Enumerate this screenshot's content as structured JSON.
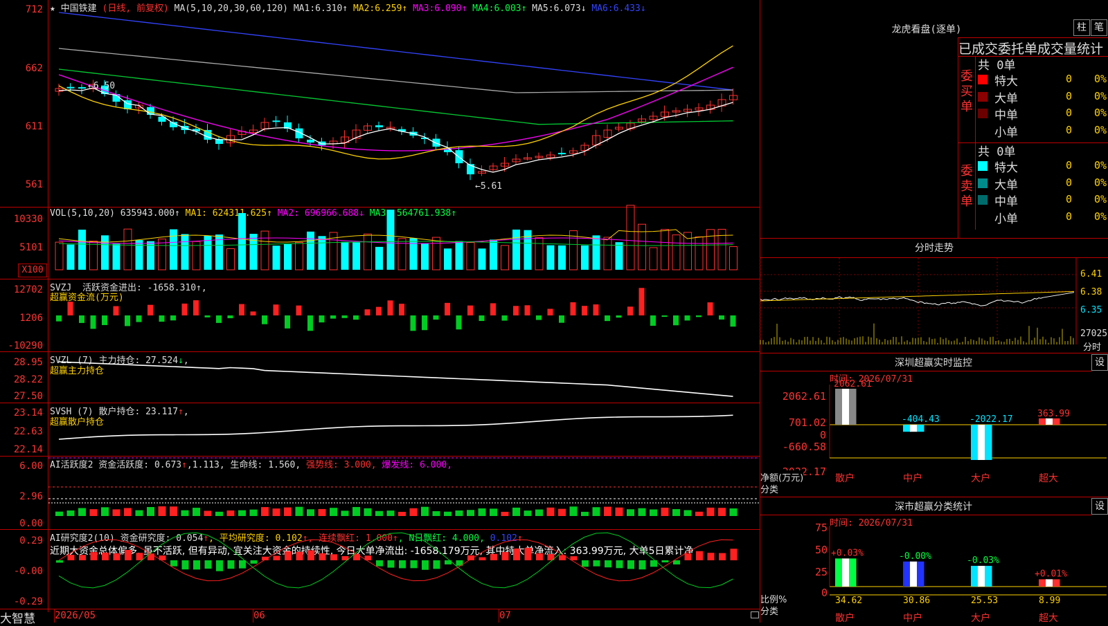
{
  "main": {
    "star": "★",
    "stock_name": "中国铁建",
    "period": "(日线, 前复权)",
    "ma_label": "MA(5,10,20,30,60,120)",
    "ma_values": [
      {
        "name": "MA1:",
        "value": "6.310↑",
        "color": "#dddddd"
      },
      {
        "name": "MA2:",
        "value": "6.259↑",
        "color": "#ffd200"
      },
      {
        "name": "MA3:",
        "value": "6.090↑",
        "color": "#ff00ff"
      },
      {
        "name": "MA4:",
        "value": "6.003↑",
        "color": "#00ff44"
      },
      {
        "name": "MA5:",
        "value": "6.073↓",
        "color": "#aaaaaa"
      },
      {
        "name": "MA6:",
        "value": "6.433↓",
        "color": "#3344ff"
      }
    ],
    "y_labels": [
      "712",
      "662",
      "611",
      "561"
    ],
    "high_note": "←6.50",
    "low_note": "←5.61"
  },
  "vol": {
    "header_name": "VOL(5,10,20)",
    "value": "635943.000↑",
    "ma1": "MA1: 624311.625↑",
    "ma2": "MA2: 696966.688↓",
    "ma3": "MA3: 564761.938↑",
    "y_labels": [
      "10330",
      "5101"
    ],
    "unit": "X100"
  },
  "svzj": {
    "header": "SVZJ  活跃资金进出: -1658.310↑,",
    "subtitle": "超赢资金流(万元)",
    "y_labels": [
      "12702",
      "1206",
      "-10290"
    ]
  },
  "svzl": {
    "header_a": "SVZL (7) 主力持仓: 27.524",
    "header_arrow": "↓",
    "header_c": ",",
    "subtitle": "超赢主力持仓",
    "y_labels": [
      "28.95",
      "28.22",
      "27.50"
    ]
  },
  "svsh": {
    "header_a": "SVSH (7) 散户持仓: 23.117",
    "header_arrow": "↑",
    "header_c": ",",
    "subtitle": "超赢散户持仓",
    "y_labels": [
      "23.14",
      "22.63",
      "22.14"
    ]
  },
  "ai1": {
    "header_a": "AI活跃度2 资金活跃度: 0.673",
    "header_b": "↑",
    "header_c": ",1.113, 生命线: 1.560, ",
    "header_d": "强势线: 3.000,",
    "header_e": " 爆发线: 6.000,",
    "y_labels": [
      "6.00",
      "2.96",
      "0.00"
    ]
  },
  "ai2": {
    "header_a": "AI研究度2(10) 资金研究度: 0.054",
    "header_b": "↑",
    "header_c": ", 平均研究度: 0.102",
    "header_d": "↑",
    "header_e": ", 连续飘红: 1.000",
    "header_f": "↑",
    "header_g": ", N日飘红: 4.000, ",
    "header_h": "0.102",
    "header_i": "↑",
    "note": "近期大资金总体偏多, 虽不活跃, 但有异动, 宜关注大资金的持续性, 今日大单净流出: -1658.179万元, 其中特大单净流入: 363.99万元, 大单5日累计净",
    "y_labels": [
      "0.29",
      "-0.00",
      "-0.29"
    ]
  },
  "footer": {
    "brand": "大智慧",
    "dates": [
      "2026/05",
      "06",
      "07"
    ]
  },
  "right": {
    "lhb_title": "龙虎看盘(逐单)",
    "btn_zhu": "柱",
    "btn_bi": "笔",
    "stat_title": "已成交委托单成交量统计",
    "buy": {
      "label": "委买单",
      "total": "共 0单",
      "rows": [
        {
          "name": "特大",
          "count": "0",
          "pct": "0%",
          "color": "#ff0000"
        },
        {
          "name": "大单",
          "count": "0",
          "pct": "0%",
          "color": "#8b0000"
        },
        {
          "name": "中单",
          "count": "0",
          "pct": "0%",
          "color": "#6b0000"
        },
        {
          "name": "小单",
          "count": "0",
          "pct": "0%",
          "color": "#000000"
        }
      ]
    },
    "sell": {
      "label": "委卖单",
      "total": "共 0单",
      "rows": [
        {
          "name": "特大",
          "count": "0",
          "pct": "0%",
          "color": "#00ffff"
        },
        {
          "name": "大单",
          "count": "0",
          "pct": "0%",
          "color": "#008b8b"
        },
        {
          "name": "中单",
          "count": "0",
          "pct": "0%",
          "color": "#006b6b"
        },
        {
          "name": "小单",
          "count": "0",
          "pct": "0%",
          "color": "#000000"
        }
      ]
    },
    "fenshi": {
      "title": "分时走势",
      "y_labels": [
        "6.41",
        "6.38",
        "6.35"
      ],
      "vol_label": "27025",
      "vol_unit": "分时"
    },
    "szmon": {
      "title": "深圳超赢实时监控",
      "btn": "设",
      "time": "时间: 2026/07/31",
      "y_labels": [
        "2062.61",
        "701.02",
        "0",
        "-660.58",
        "-2022.17"
      ],
      "side_a": "净额(万元)",
      "side_b": "分类",
      "bars": [
        {
          "cat": "散户",
          "value": 2062.61,
          "label": "2062.61"
        },
        {
          "cat": "中户",
          "value": -404.43,
          "label": "-404.43"
        },
        {
          "cat": "大户",
          "value": -2022.17,
          "label": "-2022.17"
        },
        {
          "cat": "超大",
          "value": 363.99,
          "label": "363.99"
        }
      ]
    },
    "szstat": {
      "title": "深市超赢分类统计",
      "btn": "设",
      "time": "时间: 2026/07/31",
      "y_labels": [
        "75",
        "50",
        "25",
        "0"
      ],
      "side_a": "比例%",
      "side_b": "分类",
      "bars": [
        {
          "cat": "散户",
          "value": 34.62,
          "change": "+0.03%",
          "label": "34.62"
        },
        {
          "cat": "中户",
          "value": 30.86,
          "change": "-0.00%",
          "label": "30.86"
        },
        {
          "cat": "大户",
          "value": 25.53,
          "change": "-0.03%",
          "label": "25.53"
        },
        {
          "cat": "超大",
          "value": 8.99,
          "change": "+0.01%",
          "label": "8.99"
        }
      ]
    }
  },
  "colors": {
    "up": "#ff3030",
    "down": "#00ffff",
    "frame": "#c00000"
  }
}
